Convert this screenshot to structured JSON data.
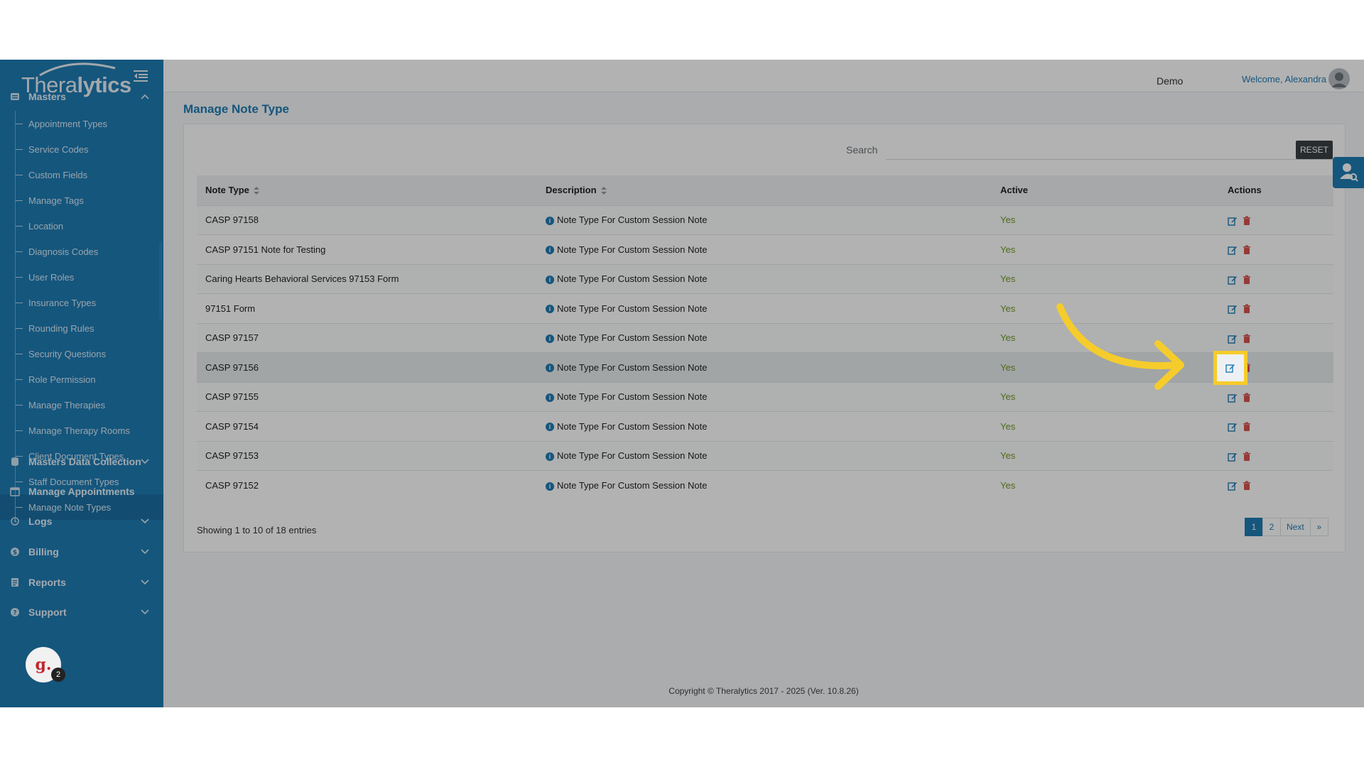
{
  "brand": {
    "logo_text_light": "Thera",
    "logo_text_bold": "lytics"
  },
  "sidebar": {
    "masters_label": "Masters",
    "sub_items": [
      {
        "label": "Appointment Types"
      },
      {
        "label": "Service Codes"
      },
      {
        "label": "Custom Fields"
      },
      {
        "label": "Manage Tags"
      },
      {
        "label": "Location"
      },
      {
        "label": "Diagnosis Codes"
      },
      {
        "label": "User Roles"
      },
      {
        "label": "Insurance Types"
      },
      {
        "label": "Rounding Rules"
      },
      {
        "label": "Security Questions"
      },
      {
        "label": "Role Permission"
      },
      {
        "label": "Manage Therapies"
      },
      {
        "label": "Manage Therapy Rooms"
      },
      {
        "label": "Client Document Types"
      },
      {
        "label": "Staff Document Types"
      },
      {
        "label": "Manage Note Types"
      }
    ],
    "sections": [
      {
        "label": "Masters Data Collection",
        "icon": "database-icon",
        "has_chevron": true
      },
      {
        "label": "Manage Appointments",
        "icon": "calendar-icon",
        "has_chevron": false
      },
      {
        "label": "Logs",
        "icon": "history-icon",
        "has_chevron": true
      },
      {
        "label": "Billing",
        "icon": "dollar-icon",
        "has_chevron": true
      },
      {
        "label": "Reports",
        "icon": "report-icon",
        "has_chevron": true
      },
      {
        "label": "Support",
        "icon": "help-icon",
        "has_chevron": true
      }
    ]
  },
  "header": {
    "org_selected": "Demo",
    "welcome": "Welcome, Alexandra"
  },
  "page": {
    "title": "Manage Note Type",
    "search_label": "Search",
    "search_value": "",
    "reset_label": "RESET"
  },
  "table": {
    "columns": [
      "Note Type",
      "Description",
      "Active",
      "Actions"
    ],
    "rows": [
      {
        "note_type": "CASP 97158",
        "description": "Note Type For Custom Session Note",
        "active": "Yes"
      },
      {
        "note_type": "CASP 97151 Note for Testing",
        "description": "Note Type For Custom Session Note",
        "active": "Yes"
      },
      {
        "note_type": "Caring Hearts Behavioral Services 97153 Form",
        "description": "Note Type For Custom Session Note",
        "active": "Yes"
      },
      {
        "note_type": "97151 Form",
        "description": "Note Type For Custom Session Note",
        "active": "Yes"
      },
      {
        "note_type": "CASP 97157",
        "description": "Note Type For Custom Session Note",
        "active": "Yes"
      },
      {
        "note_type": "CASP 97156",
        "description": "Note Type For Custom Session Note",
        "active": "Yes"
      },
      {
        "note_type": "CASP 97155",
        "description": "Note Type For Custom Session Note",
        "active": "Yes"
      },
      {
        "note_type": "CASP 97154",
        "description": "Note Type For Custom Session Note",
        "active": "Yes"
      },
      {
        "note_type": "CASP 97153",
        "description": "Note Type For Custom Session Note",
        "active": "Yes"
      },
      {
        "note_type": "CASP 97152",
        "description": "Note Type For Custom Session Note",
        "active": "Yes"
      }
    ],
    "highlighted_row": 5,
    "entries_info": "Showing 1 to 10 of 18 entries"
  },
  "pagination": {
    "pages": [
      "1",
      "2"
    ],
    "current": "1",
    "next_label": "Next",
    "last_label": "»"
  },
  "footer": {
    "copyright": "Copyright © Theralytics 2017 - 2025 (Ver. 10.8.26)"
  },
  "chat_widget": {
    "letter": "g.",
    "count": "2"
  },
  "colors": {
    "primary": "#1f7bb4",
    "active_text": "#6f9a1f",
    "delete": "#d9534f",
    "highlight": "#f5cc2b"
  }
}
